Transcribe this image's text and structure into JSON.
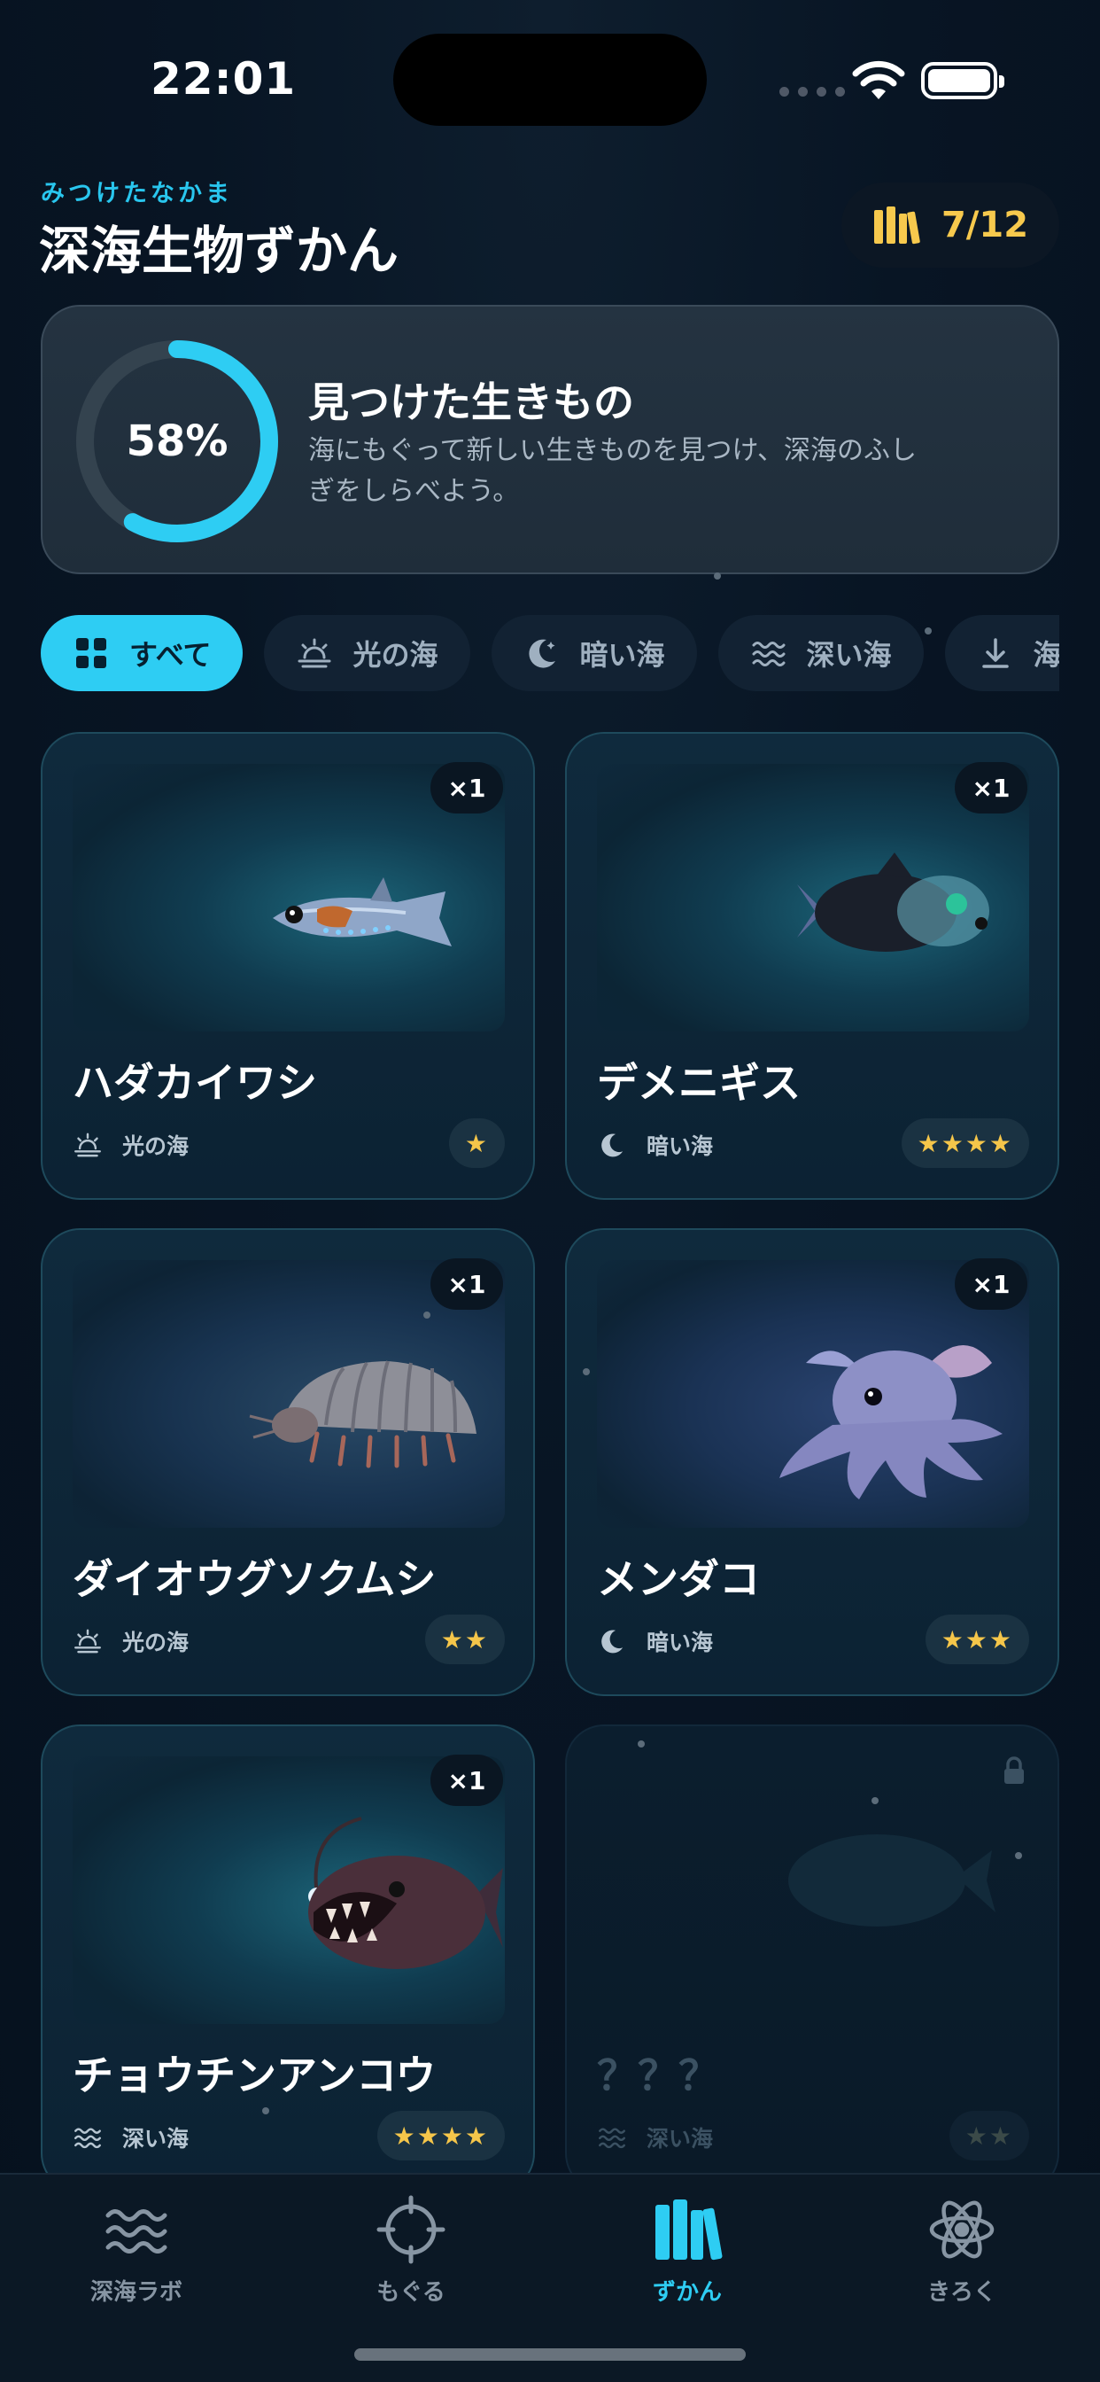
{
  "status": {
    "time": "22:01"
  },
  "header": {
    "eyebrow": "みつけたなかま",
    "title": "深海生物ずかん",
    "count": "7/12"
  },
  "progress": {
    "percent": 0.58,
    "percent_label": "58%",
    "title": "見つけた生きもの",
    "description": "海にもぐって新しい生きものを見つけ、深海のふしぎをしらべよう。"
  },
  "filters": [
    {
      "label": "すべて",
      "icon": "grid-icon",
      "active": true
    },
    {
      "label": "光の海",
      "icon": "sunrise-icon",
      "active": false
    },
    {
      "label": "暗い海",
      "icon": "moon-icon",
      "active": false
    },
    {
      "label": "深い海",
      "icon": "waves-icon",
      "active": false
    },
    {
      "label": "海の",
      "icon": "down-arrow-icon",
      "active": false
    }
  ],
  "cards": [
    {
      "name": "ハダカイワシ",
      "zone": "光の海",
      "zone_icon": "sunrise-icon",
      "count": "×1",
      "stars": "★",
      "creature": "lanternfish"
    },
    {
      "name": "デメニギス",
      "zone": "暗い海",
      "zone_icon": "moon-icon",
      "count": "×1",
      "stars": "★★★★",
      "creature": "barreleye"
    },
    {
      "name": "ダイオウグソクムシ",
      "zone": "光の海",
      "zone_icon": "sunrise-icon",
      "count": "×1",
      "stars": "★★",
      "creature": "giant-isopod"
    },
    {
      "name": "メンダコ",
      "zone": "暗い海",
      "zone_icon": "moon-icon",
      "count": "×1",
      "stars": "★★★",
      "creature": "dumbo-octopus"
    },
    {
      "name": "チョウチンアンコウ",
      "zone": "深い海",
      "zone_icon": "waves-icon",
      "count": "×1",
      "stars": "★★★★",
      "creature": "anglerfish"
    },
    {
      "name": "？？？",
      "zone": "深い海",
      "zone_icon": "waves-icon",
      "count": "",
      "stars": "★★",
      "creature": "unknown",
      "locked": true
    }
  ],
  "tabs": [
    {
      "label": "深海ラボ",
      "icon": "waves-icon",
      "active": false
    },
    {
      "label": "もぐる",
      "icon": "crosshair-icon",
      "active": false
    },
    {
      "label": "ずかん",
      "icon": "books-icon",
      "active": true
    },
    {
      "label": "きろく",
      "icon": "atom-icon",
      "active": false
    }
  ],
  "colors": {
    "accent": "#2ecdf3",
    "gold": "#f7c94d",
    "background": "#081524"
  }
}
